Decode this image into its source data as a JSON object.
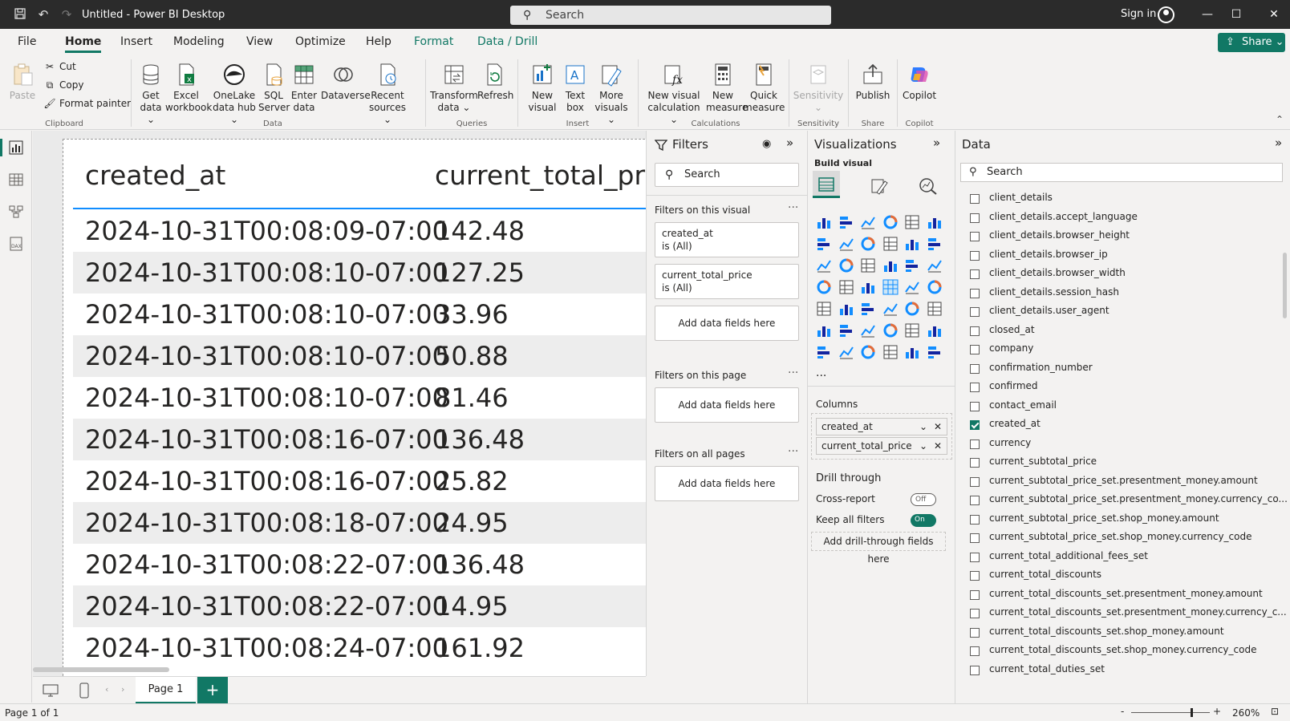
{
  "app": {
    "title": "Untitled - Power BI Desktop",
    "search_placeholder": "Search",
    "signin": "Sign in"
  },
  "menu": {
    "tabs": [
      "File",
      "Home",
      "Insert",
      "Modeling",
      "View",
      "Optimize",
      "Help",
      "Format",
      "Data / Drill"
    ],
    "share": "Share"
  },
  "ribbon": {
    "clipboard": {
      "paste": "Paste",
      "cut": "Cut",
      "copy": "Copy",
      "format_painter": "Format painter",
      "label": "Clipboard"
    },
    "data": {
      "get_data": "Get data",
      "excel": "Excel workbook",
      "onelake": "OneLake data hub",
      "sql": "SQL Server",
      "enter": "Enter data",
      "dataverse": "Dataverse",
      "recent": "Recent sources",
      "label": "Data"
    },
    "queries": {
      "transform": "Transform data",
      "refresh": "Refresh",
      "label": "Queries"
    },
    "insert": {
      "new_visual": "New visual",
      "text_box": "Text box",
      "more_visuals": "More visuals",
      "label": "Insert"
    },
    "calculations": {
      "new_visual_calc": "New visual calculation",
      "new_measure": "New measure",
      "quick_measure": "Quick measure",
      "label": "Calculations"
    },
    "sensitivity": {
      "btn": "Sensitivity",
      "label": "Sensitivity"
    },
    "share": {
      "publish": "Publish",
      "label": "Share"
    },
    "copilot": {
      "btn": "Copilot",
      "label": "Copilot"
    }
  },
  "table": {
    "headers": [
      "created_at",
      "current_total_pr"
    ],
    "rows": [
      [
        "2024-10-31T00:08:09-07:00",
        "142.48"
      ],
      [
        "2024-10-31T00:08:10-07:00",
        "127.25"
      ],
      [
        "2024-10-31T00:08:10-07:00",
        "33.96"
      ],
      [
        "2024-10-31T00:08:10-07:00",
        "50.88"
      ],
      [
        "2024-10-31T00:08:10-07:00",
        "81.46"
      ],
      [
        "2024-10-31T00:08:16-07:00",
        "136.48"
      ],
      [
        "2024-10-31T00:08:16-07:00",
        "25.82"
      ],
      [
        "2024-10-31T00:08:18-07:00",
        "24.95"
      ],
      [
        "2024-10-31T00:08:22-07:00",
        "136.48"
      ],
      [
        "2024-10-31T00:08:22-07:00",
        "14.95"
      ],
      [
        "2024-10-31T00:08:24-07:00",
        "161.92"
      ]
    ]
  },
  "pages": {
    "tab": "Page 1",
    "add": "+"
  },
  "status": {
    "page_of": "Page 1 of 1",
    "zoom": "260%"
  },
  "filters": {
    "title": "Filters",
    "search": "Search",
    "on_visual": "Filters on this visual",
    "on_page": "Filters on this page",
    "on_all": "Filters on all pages",
    "add_fields": "Add data fields here",
    "cards": [
      {
        "field": "created_at",
        "state": "is (All)"
      },
      {
        "field": "current_total_price",
        "state": "is (All)"
      }
    ]
  },
  "viz": {
    "title": "Visualizations",
    "build": "Build visual",
    "columns": "Columns",
    "wells": [
      "created_at",
      "current_total_price"
    ],
    "drill": "Drill through",
    "cross": "Cross-report",
    "cross_state": "Off",
    "keep": "Keep all filters",
    "keep_state": "On",
    "add_drill": "Add drill-through fields here",
    "more": "..."
  },
  "data": {
    "title": "Data",
    "search": "Search",
    "fields": [
      {
        "name": "client_details",
        "checked": false
      },
      {
        "name": "client_details.accept_language",
        "checked": false
      },
      {
        "name": "client_details.browser_height",
        "checked": false
      },
      {
        "name": "client_details.browser_ip",
        "checked": false
      },
      {
        "name": "client_details.browser_width",
        "checked": false
      },
      {
        "name": "client_details.session_hash",
        "checked": false
      },
      {
        "name": "client_details.user_agent",
        "checked": false
      },
      {
        "name": "closed_at",
        "checked": false
      },
      {
        "name": "company",
        "checked": false
      },
      {
        "name": "confirmation_number",
        "checked": false
      },
      {
        "name": "confirmed",
        "checked": false
      },
      {
        "name": "contact_email",
        "checked": false
      },
      {
        "name": "created_at",
        "checked": true
      },
      {
        "name": "currency",
        "checked": false
      },
      {
        "name": "current_subtotal_price",
        "checked": false
      },
      {
        "name": "current_subtotal_price_set.presentment_money.amount",
        "checked": false
      },
      {
        "name": "current_subtotal_price_set.presentment_money.currency_co...",
        "checked": false
      },
      {
        "name": "current_subtotal_price_set.shop_money.amount",
        "checked": false
      },
      {
        "name": "current_subtotal_price_set.shop_money.currency_code",
        "checked": false
      },
      {
        "name": "current_total_additional_fees_set",
        "checked": false
      },
      {
        "name": "current_total_discounts",
        "checked": false
      },
      {
        "name": "current_total_discounts_set.presentment_money.amount",
        "checked": false
      },
      {
        "name": "current_total_discounts_set.presentment_money.currency_c...",
        "checked": false
      },
      {
        "name": "current_total_discounts_set.shop_money.amount",
        "checked": false
      },
      {
        "name": "current_total_discounts_set.shop_money.currency_code",
        "checked": false
      },
      {
        "name": "current_total_duties_set",
        "checked": false
      }
    ]
  },
  "colors": {
    "accent": "#117865",
    "table_rule": "#118dff"
  }
}
